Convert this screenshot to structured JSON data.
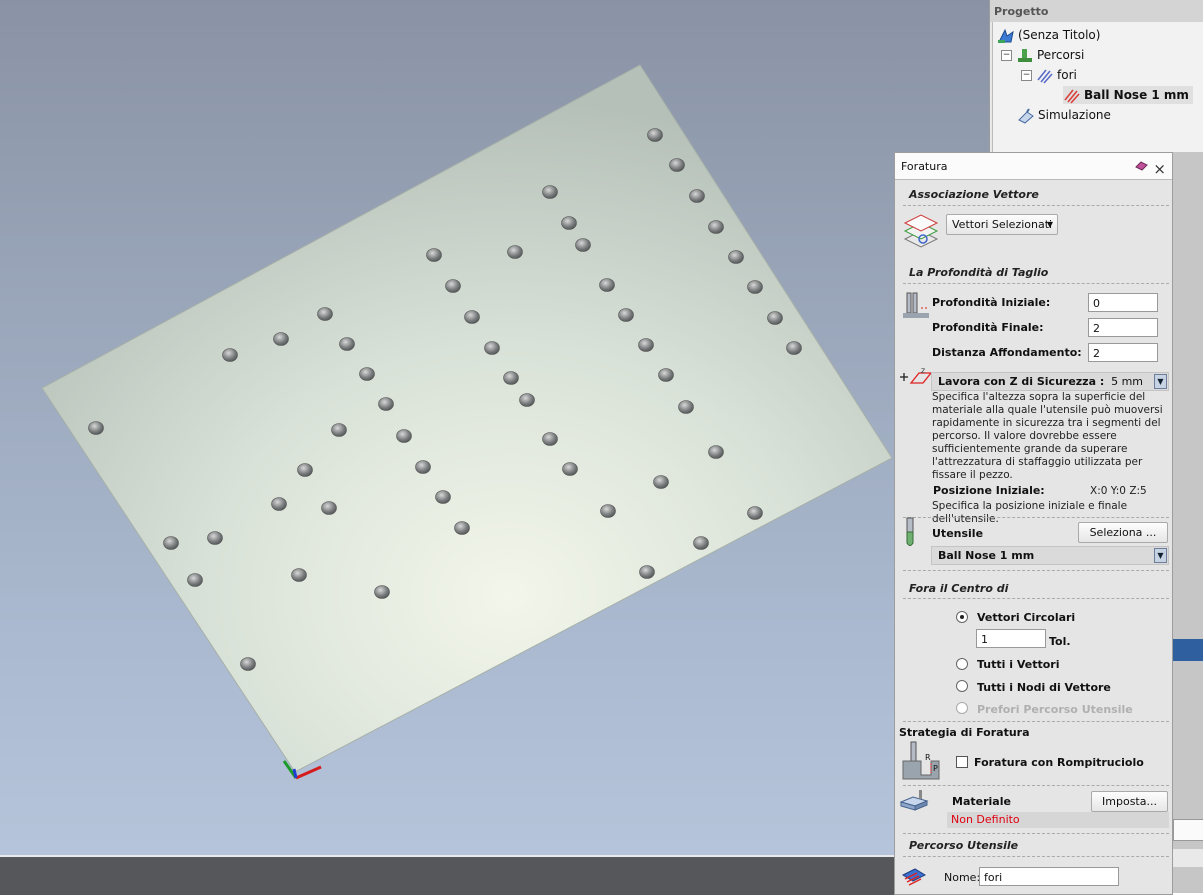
{
  "project": {
    "header": "Progetto",
    "tree": [
      {
        "label": "(Senza Titolo)",
        "icon": "project-icon"
      },
      {
        "label": "Percorsi",
        "icon": "toolpaths-icon",
        "toggle": "−"
      },
      {
        "label": "fori",
        "icon": "drill-group-icon",
        "toggle": "−"
      },
      {
        "label": "Ball Nose 1 mm",
        "icon": "drill-toolpath-icon",
        "selected": true
      },
      {
        "label": "Simulazione",
        "icon": "simulation-icon"
      }
    ]
  },
  "foratura": {
    "title": "Foratura",
    "vector_section": {
      "heading": "Associazione Vettore",
      "selection_mode": "Vettori Selezionati"
    },
    "depth_section": {
      "heading": "La Profondità di Taglio",
      "start_depth_label": "Profondità Iniziale:",
      "start_depth_value": "0",
      "final_depth_label": "Profondità Finale:",
      "final_depth_value": "2",
      "plunge_label": "Distanza Affondamento:",
      "plunge_value": "2"
    },
    "safe_z": {
      "label": "Lavora con Z di Sicurezza :",
      "value": "5 mm",
      "help": "Specifica l'altezza sopra la superficie del materiale alla quale l'utensile può muoversi rapidamente in sicurezza tra i segmenti del percorso. Il valore dovrebbe essere sufficientemente grande da superare l'attrezzatura di staffaggio utilizzata per fissare il pezzo.",
      "home_label": "Posizione Iniziale:",
      "home_value": "X:0 Y:0 Z:5",
      "home_help": "Specifica la posizione iniziale e finale dell'utensile."
    },
    "tool": {
      "label": "Utensile",
      "select_button": "Seleziona ...",
      "tool_name": "Ball Nose 1 mm"
    },
    "drill_center": {
      "heading": "Fora il Centro di",
      "options": [
        {
          "label": "Vettori Circolari",
          "checked": true,
          "enabled": true
        },
        {
          "label": "Tutti i Vettori",
          "checked": false,
          "enabled": true
        },
        {
          "label": "Tutti i Nodi di Vettore",
          "checked": false,
          "enabled": true
        },
        {
          "label": "Prefori Percorso Utensile",
          "checked": false,
          "enabled": false
        }
      ],
      "tolerance_value": "1",
      "tolerance_label": "Tol."
    },
    "strategy": {
      "heading": "Strategia di Foratura",
      "peck_label": "Foratura con Rompitruciolo",
      "peck_checked": false
    },
    "material": {
      "label": "Materiale",
      "button": "Imposta...",
      "status": "Non Definito",
      "status_color": "#e0000f"
    },
    "toolpath": {
      "heading": "Percorso Utensile",
      "name_label": "Nome:",
      "name_value": "fori"
    }
  }
}
